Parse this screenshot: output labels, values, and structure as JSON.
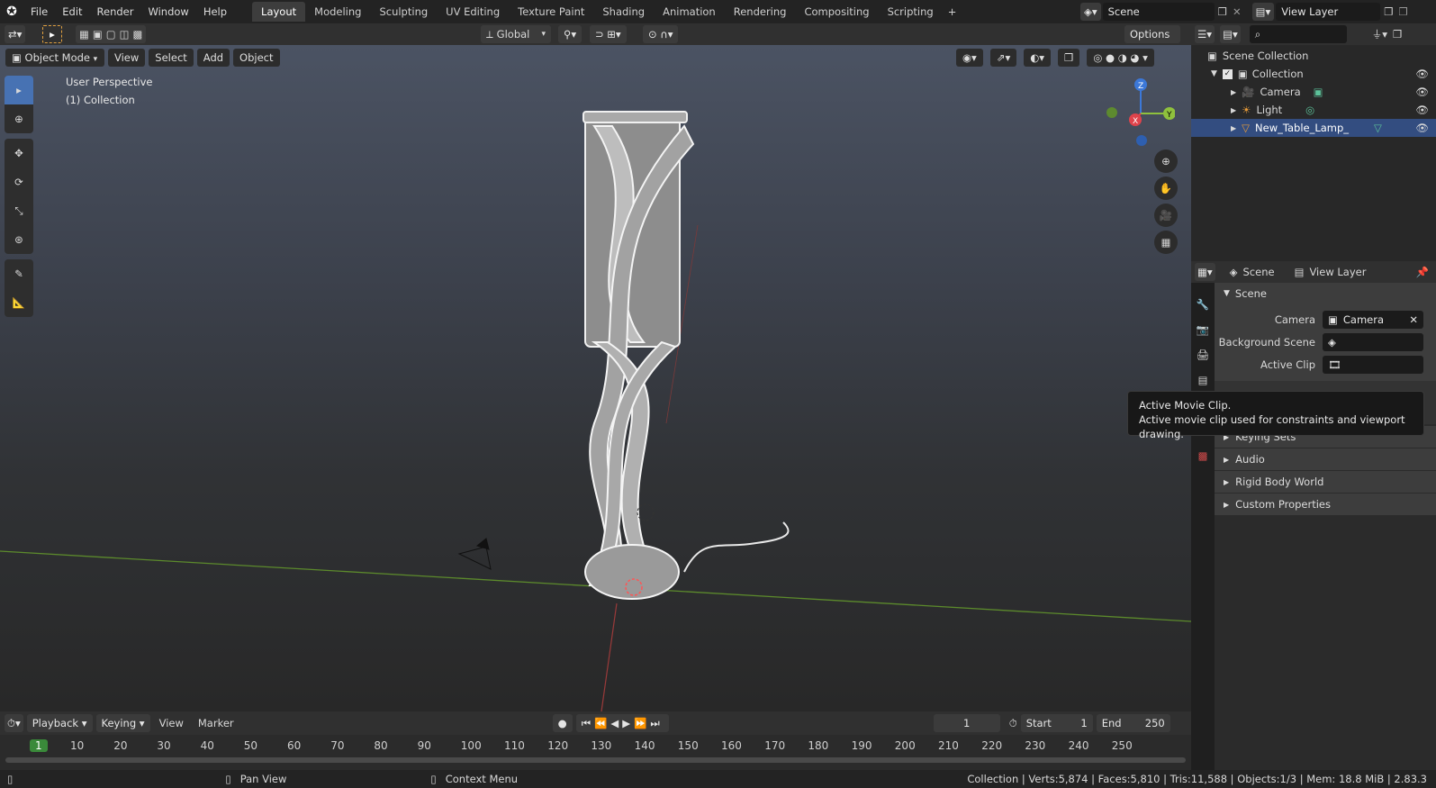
{
  "menus": [
    "File",
    "Edit",
    "Render",
    "Window",
    "Help"
  ],
  "workspaces": [
    "Layout",
    "Modeling",
    "Sculpting",
    "UV Editing",
    "Texture Paint",
    "Shading",
    "Animation",
    "Rendering",
    "Compositing",
    "Scripting"
  ],
  "active_workspace": "Layout",
  "scene": {
    "label": "Scene"
  },
  "view_layer": {
    "label": "View Layer"
  },
  "header2": {
    "transform_orientation": "Global",
    "options_label": "Options"
  },
  "viewport": {
    "mode": "Object Mode",
    "menus": [
      "View",
      "Select",
      "Add",
      "Object"
    ],
    "overlay_title": "User Perspective",
    "overlay_collection": "(1) Collection",
    "gizmo": {
      "z": "Z",
      "y": "Y",
      "x": "X"
    }
  },
  "outliner": {
    "search_placeholder": "",
    "items": [
      {
        "label": "Scene Collection"
      },
      {
        "label": "Collection"
      },
      {
        "label": "Camera"
      },
      {
        "label": "Light"
      },
      {
        "label": "New_Table_Lamp_"
      }
    ]
  },
  "properties": {
    "scene_tab": "Scene",
    "view_layer_tab": "View Layer",
    "panel_title": "Scene",
    "camera_label": "Camera",
    "camera_value": "Camera",
    "background_scene_label": "Background Scene",
    "active_clip_label": "Active Clip",
    "panels": [
      "Keying Sets",
      "Audio",
      "Rigid Body World",
      "Custom Properties"
    ]
  },
  "tooltip": {
    "title": "Active Movie Clip.",
    "description": "Active movie clip used for constraints and viewport drawing."
  },
  "timeline": {
    "menus": [
      "Playback",
      "Keying",
      "View",
      "Marker"
    ],
    "current_frame": "1",
    "start_label": "Start",
    "start_value": "1",
    "end_label": "End",
    "end_value": "250",
    "ruler": [
      "1",
      "10",
      "20",
      "30",
      "40",
      "50",
      "60",
      "70",
      "80",
      "90",
      "100",
      "110",
      "120",
      "130",
      "140",
      "150",
      "160",
      "170",
      "180",
      "190",
      "200",
      "210",
      "220",
      "230",
      "240",
      "250"
    ]
  },
  "statusbar": {
    "pan": "Pan View",
    "context": "Context Menu",
    "stats": "Collection | Verts:5,874 | Faces:5,810 | Tris:11,588 | Objects:1/3 | Mem: 18.8 MiB | 2.83.3"
  },
  "colors": {
    "accent": "#4772b3",
    "x_axis": "#e0434b",
    "y_axis": "#8fc13d",
    "z_axis": "#3c78d8"
  }
}
